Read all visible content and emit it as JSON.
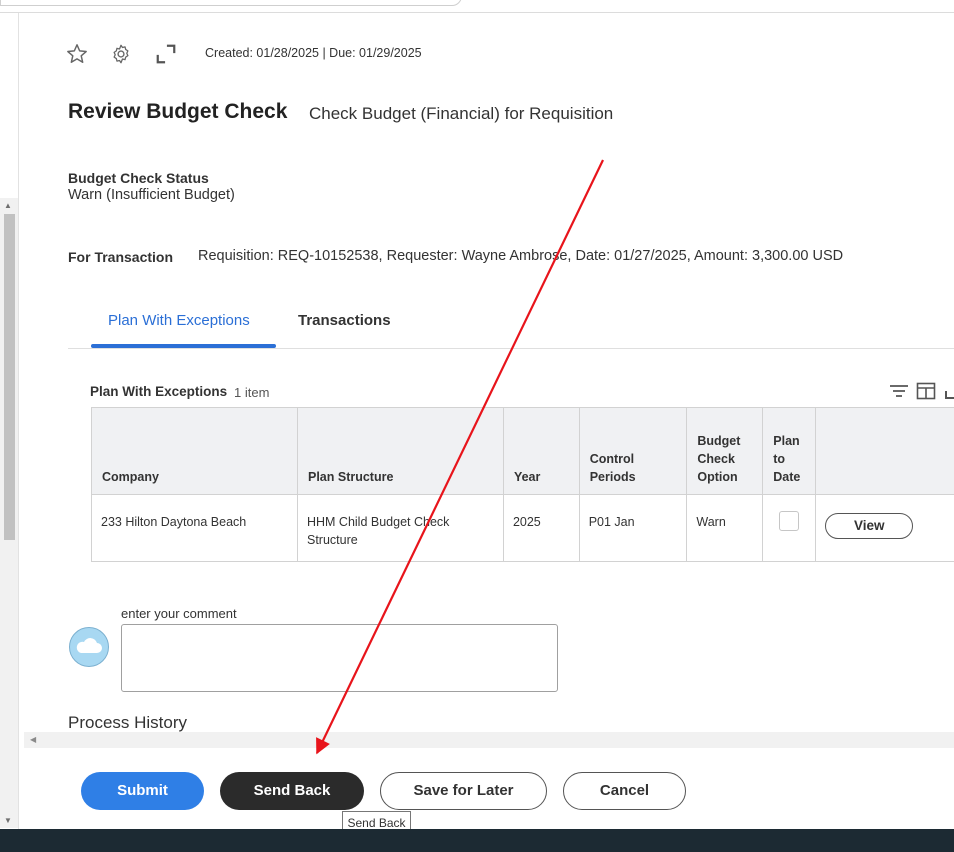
{
  "header": {
    "meta": "Created: 01/28/2025 | Due: 01/29/2025",
    "title": "Review Budget Check",
    "subtitle": "Check Budget (Financial) for Requisition",
    "icons": [
      "star-icon",
      "gear-icon",
      "expand-icon"
    ]
  },
  "status": {
    "label": "Budget Check Status",
    "value": "Warn (Insufficient Budget)"
  },
  "transaction": {
    "label": "For Transaction",
    "value": "Requisition: REQ-10152538, Requester: Wayne Ambrose, Date: 01/27/2025, Amount: 3,300.00 USD"
  },
  "tabs": [
    {
      "label": "Plan With Exceptions",
      "active": true
    },
    {
      "label": "Transactions",
      "active": false
    }
  ],
  "grid": {
    "title": "Plan With Exceptions",
    "count": "1 item",
    "toolbar_icons": [
      "filter-icon",
      "columns-icon",
      "fullscreen-icon"
    ],
    "columns": [
      "Company",
      "Plan Structure",
      "Year",
      "Control Periods",
      "Budget Check Option",
      "Plan to Date",
      ""
    ],
    "rows": [
      {
        "company": "233 Hilton Daytona Beach",
        "plan_structure": "HHM Child Budget Check Structure",
        "year": "2025",
        "control_periods": "P01 Jan",
        "budget_check_option": "Warn",
        "plan_to_date": false,
        "action": "View"
      }
    ]
  },
  "comment": {
    "placeholder": "enter your comment",
    "value": ""
  },
  "process_history": {
    "label": "Process History"
  },
  "buttons": {
    "submit": "Submit",
    "send_back": "Send Back",
    "save_for_later": "Save for Later",
    "cancel": "Cancel"
  },
  "tooltip": "Send Back",
  "colors": {
    "accent": "#2f7fe6",
    "dark_button": "#2b2b2b",
    "annotation_arrow": "#e8141b"
  }
}
